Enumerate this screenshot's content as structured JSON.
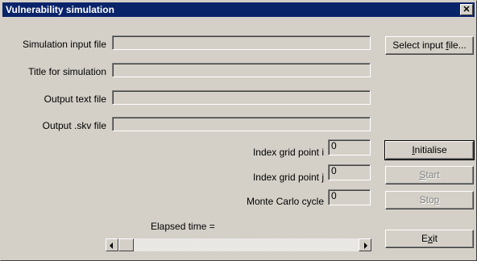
{
  "window": {
    "title": "Vulnerability simulation",
    "close_glyph": "✕"
  },
  "labels": {
    "simulation_input_file": "Simulation input file",
    "title_for_simulation": "Title for simulation",
    "output_text_file": "Output text file",
    "output_skv_file": "Output .skv file",
    "index_grid_point_i": "Index grid point i",
    "index_grid_point_j": "Index grid point j",
    "monte_carlo_cycle": "Monte Carlo cycle",
    "elapsed_time": "Elapsed time ="
  },
  "fields": {
    "simulation_input_file": "",
    "title_for_simulation": "",
    "output_text_file": "",
    "output_skv_file": "",
    "index_i": "0",
    "index_j": "0",
    "monte_carlo_cycle": "0"
  },
  "buttons": {
    "select_input_file": {
      "pre": "Select input ",
      "u": "f",
      "post": "ile..."
    },
    "initialise": {
      "pre": "",
      "u": "I",
      "post": "nitialise"
    },
    "start": {
      "pre": "",
      "u": "S",
      "post": "tart"
    },
    "stop": {
      "pre": "Sto",
      "u": "p",
      "post": ""
    },
    "exit": {
      "pre": "E",
      "u": "x",
      "post": "it"
    }
  },
  "scrollbar": {
    "position": 0
  },
  "icons": {
    "close": "close-icon",
    "scroll_left": "arrow-left-icon",
    "scroll_right": "arrow-right-icon"
  }
}
